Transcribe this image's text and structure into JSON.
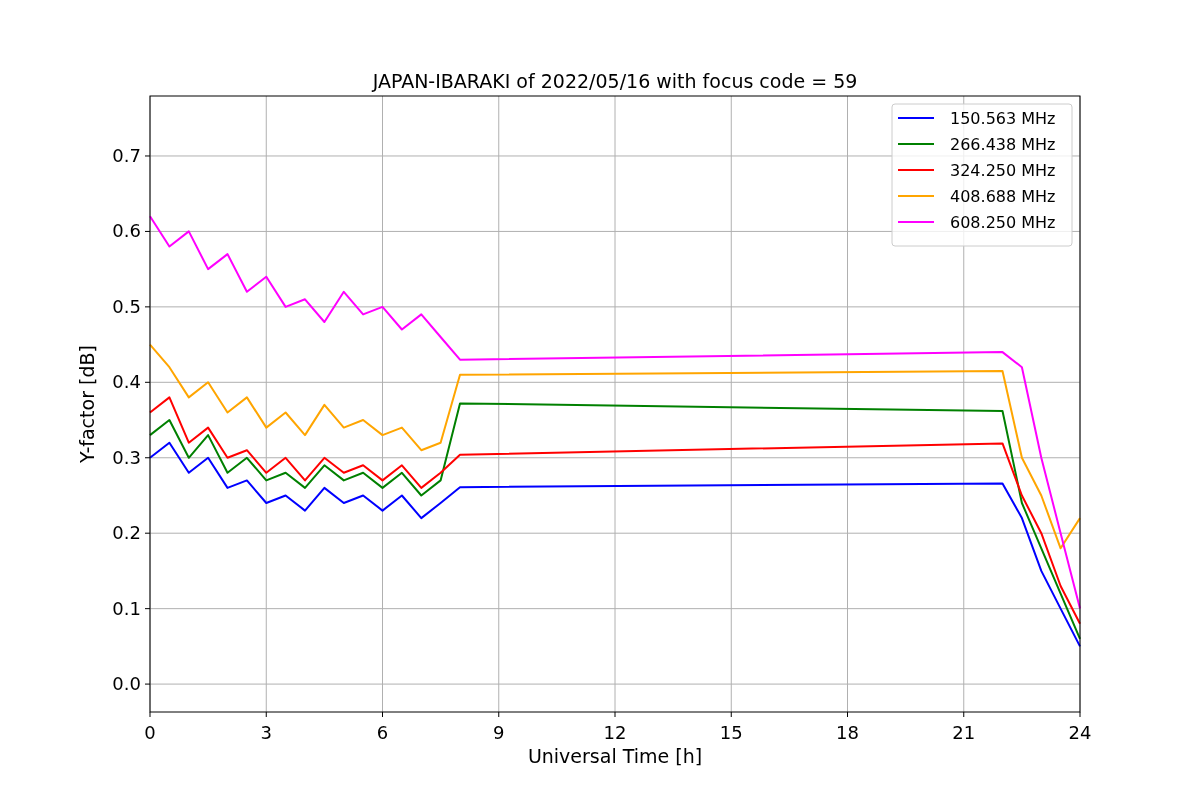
{
  "figure": {
    "chart_data": {
      "type": "line",
      "title": "JAPAN-IBARAKI of 2022/05/16 with focus code = 59",
      "xlabel": "Universal Time [h]",
      "ylabel": "Y-factor [dB]",
      "x": [
        0,
        0.5,
        1,
        1.5,
        2,
        2.5,
        3,
        3.5,
        4,
        4.5,
        5,
        5.5,
        6,
        6.5,
        7,
        7.5,
        8,
        22,
        22.5,
        23,
        23.5,
        24
      ],
      "series": [
        {
          "name": "150.563 MHz",
          "color": "#0000ff",
          "values": [
            0.3,
            0.32,
            0.28,
            0.3,
            0.26,
            0.27,
            0.24,
            0.25,
            0.23,
            0.26,
            0.24,
            0.25,
            0.23,
            0.25,
            0.22,
            0.24,
            0.261,
            0.266,
            0.22,
            0.15,
            0.1,
            0.05
          ]
        },
        {
          "name": "266.438 MHz",
          "color": "#008000",
          "values": [
            0.33,
            0.35,
            0.3,
            0.33,
            0.28,
            0.3,
            0.27,
            0.28,
            0.26,
            0.29,
            0.27,
            0.28,
            0.26,
            0.28,
            0.25,
            0.27,
            0.372,
            0.362,
            0.24,
            0.18,
            0.12,
            0.06
          ]
        },
        {
          "name": "324.250 MHz",
          "color": "#ff0000",
          "values": [
            0.36,
            0.38,
            0.32,
            0.34,
            0.3,
            0.31,
            0.28,
            0.3,
            0.27,
            0.3,
            0.28,
            0.29,
            0.27,
            0.29,
            0.26,
            0.28,
            0.304,
            0.319,
            0.25,
            0.2,
            0.13,
            0.08
          ]
        },
        {
          "name": "408.688 MHz",
          "color": "#ffa500",
          "values": [
            0.45,
            0.42,
            0.38,
            0.4,
            0.36,
            0.38,
            0.34,
            0.36,
            0.33,
            0.37,
            0.34,
            0.35,
            0.33,
            0.34,
            0.31,
            0.32,
            0.41,
            0.415,
            0.3,
            0.25,
            0.18,
            0.22
          ]
        },
        {
          "name": "608.250 MHz",
          "color": "#ff00ff",
          "values": [
            0.62,
            0.58,
            0.6,
            0.55,
            0.57,
            0.52,
            0.54,
            0.5,
            0.51,
            0.48,
            0.52,
            0.49,
            0.5,
            0.47,
            0.49,
            0.46,
            0.43,
            0.44,
            0.42,
            0.3,
            0.2,
            0.1
          ]
        }
      ],
      "grid": true,
      "legend": "upper right",
      "xlim": [
        0,
        24
      ],
      "ylim": [
        -0.037,
        0.7795
      ],
      "xticks": [
        0,
        3,
        6,
        9,
        12,
        15,
        18,
        21,
        24
      ],
      "yticks": [
        {
          "value": 0,
          "label": "0.0"
        },
        {
          "value": 0.1,
          "label": "0.1"
        },
        {
          "value": 0.2,
          "label": "0.2"
        },
        {
          "value": 0.3,
          "label": "0.3"
        },
        {
          "value": 0.4,
          "label": "0.4"
        },
        {
          "value": 0.5,
          "label": "0.5"
        },
        {
          "value": 0.6,
          "label": "0.6"
        },
        {
          "value": 0.7,
          "label": "0.7"
        }
      ]
    }
  }
}
